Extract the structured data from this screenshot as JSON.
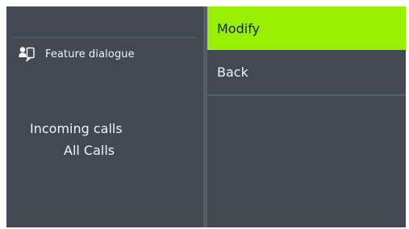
{
  "left_panel": {
    "feature_label": "Feature dialogue",
    "feature_icon": "person-chat-icon",
    "incoming_label": "Incoming calls",
    "incoming_value": "All Calls"
  },
  "menu": {
    "items": [
      {
        "label": "Modify",
        "selected": true
      },
      {
        "label": "Back",
        "selected": false
      }
    ]
  },
  "colors": {
    "background": "#424953",
    "selection": "#99ef00",
    "text": "#f1f3f5",
    "selected_text": "#1c2222"
  }
}
